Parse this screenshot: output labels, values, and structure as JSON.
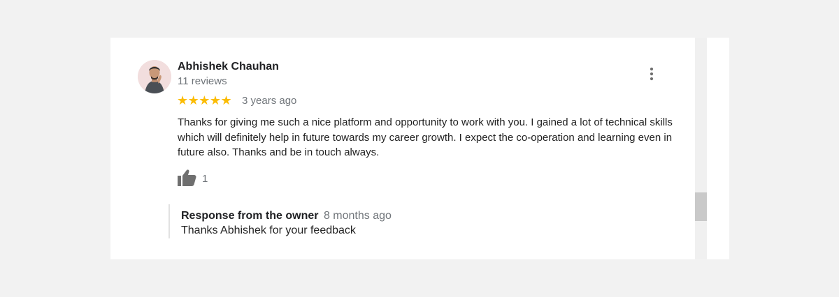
{
  "review": {
    "reviewer_name": "Abhishek Chauhan",
    "review_count": "11 reviews",
    "stars": "★★★★★",
    "rating": 5,
    "time_ago": "3 years ago",
    "text": "Thanks for giving me such a nice platform and opportunity to work with you. I gained a lot of technical skills which will definitely help in future towards my career growth. I expect the co-operation and learning even in future also. Thanks and be in touch always.",
    "like_count": "1",
    "icons": {
      "more": "more-vert-icon",
      "like": "thumbs-up-icon"
    }
  },
  "owner_response": {
    "title": "Response from the owner",
    "time_ago": "8 months ago",
    "text": "Thanks Abhishek for your feedback"
  },
  "colors": {
    "star": "#fbbc04",
    "secondary_text": "#70757a",
    "icon": "#6f6f6f"
  }
}
